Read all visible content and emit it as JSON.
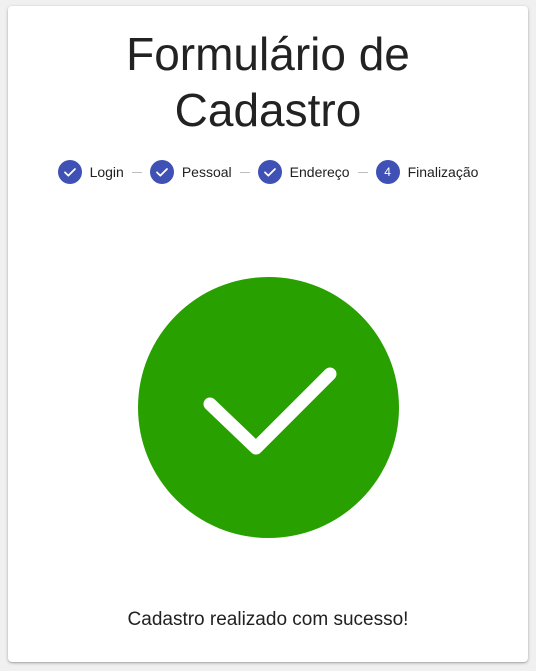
{
  "form": {
    "title_line1": "Formulário de",
    "title_line2": "Cadastro"
  },
  "stepper": {
    "steps": [
      {
        "label": "Login",
        "state": "completed",
        "icon": "check-icon"
      },
      {
        "label": "Pessoal",
        "state": "completed",
        "icon": "check-icon"
      },
      {
        "label": "Endereço",
        "state": "completed",
        "icon": "check-icon"
      },
      {
        "label": "Finalização",
        "state": "active",
        "number": "4"
      }
    ],
    "accent_color": "#3f51b5"
  },
  "result": {
    "icon": "success-check-icon",
    "color": "#28a000",
    "message": "Cadastro realizado com sucesso!"
  }
}
